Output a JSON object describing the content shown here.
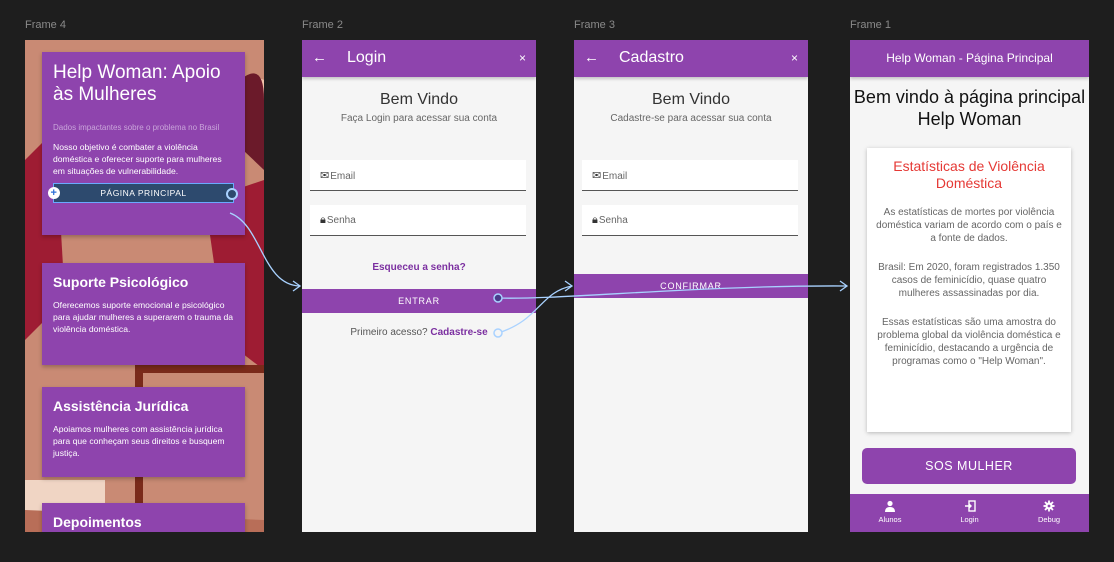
{
  "frames": {
    "f4_label": "Frame 4",
    "f2_label": "Frame 2",
    "f3_label": "Frame 3",
    "f1_label": "Frame 1"
  },
  "frame4": {
    "hero_title": "Help Woman: Apoio às Mulheres",
    "hero_subtitle": "Dados impactantes sobre o problema no Brasil",
    "hero_body": "Nosso objetivo é combater a violência doméstica e oferecer suporte para mulheres em situações de vulnerabilidade.",
    "hero_button": "PÁGINA PRINCIPAL",
    "card2_title": "Suporte Psicológico",
    "card2_body": "Oferecemos suporte emocional e psicológico para ajudar mulheres a superarem o trauma da violência doméstica.",
    "card3_title": "Assistência Jurídica",
    "card3_body": "Apoiamos mulheres com assistência jurídica para que conheçam seus direitos e busquem justiça.",
    "card4_title": "Depoimentos"
  },
  "login": {
    "title": "Login",
    "back_icon": "←",
    "close_icon": "×",
    "welcome": "Bem Vindo",
    "subtitle": "Faça Login para acessar sua conta",
    "email_placeholder": "Email",
    "password_placeholder": "Senha",
    "forgot": "Esqueceu a senha?",
    "enter_button": "ENTRAR",
    "first_access": "Primeiro acesso?",
    "signup_link": "Cadastre-se"
  },
  "signup": {
    "title": "Cadastro",
    "back_icon": "←",
    "close_icon": "×",
    "welcome": "Bem Vindo",
    "subtitle": "Cadastre-se para acessar sua conta",
    "email_placeholder": "Email",
    "password_placeholder": "Senha",
    "confirm_button": "CONFIRMAR"
  },
  "home": {
    "appbar_title": "Help Woman - Página Principal",
    "heading": "Bem vindo à página principal Help Woman",
    "stats_title": "Estatísticas de Violência Doméstica",
    "para1": "As estatísticas de mortes por violência doméstica variam de acordo com o país e a fonte de dados.",
    "para2": "Brasil: Em 2020, foram registrados 1.350 casos de feminicídio, quase quatro mulheres assassinadas por dia.",
    "para3": "Essas estatísticas são uma amostra do problema global da violência doméstica e feminicídio, destacando a urgência de programas como o \"Help Woman\".",
    "sos_button": "SOS MULHER",
    "nav": [
      {
        "label": "Alunos",
        "icon": "person-icon"
      },
      {
        "label": "Login",
        "icon": "login-icon"
      },
      {
        "label": "Debug",
        "icon": "gear-icon"
      }
    ]
  },
  "colors": {
    "primary": "#8e44ad",
    "stats_title": "#e53935",
    "canvas": "#1e1e1e",
    "wire": "#a9d2ff"
  }
}
